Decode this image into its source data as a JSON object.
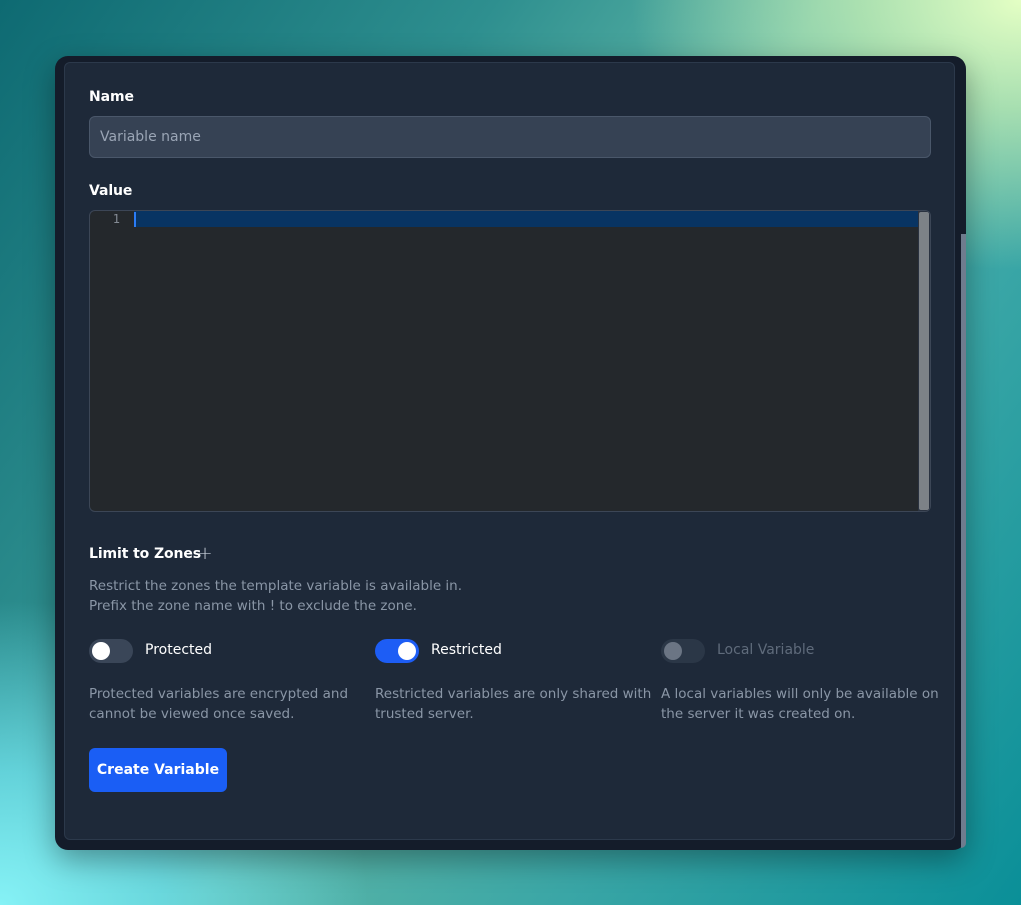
{
  "form": {
    "name": {
      "label": "Name",
      "value": "",
      "placeholder": "Variable name"
    },
    "value": {
      "label": "Value",
      "line_numbers": [
        "1"
      ],
      "content": ""
    },
    "zones": {
      "label": "Limit to Zones",
      "add_icon": "plus-icon",
      "add_glyph": "+",
      "help_lines": [
        "Restrict the zones the template variable is available in.",
        "Prefix the zone name with ! to exclude the zone."
      ]
    },
    "options": [
      {
        "label": "Protected",
        "checked": false,
        "disabled": false,
        "help_lines": [
          "Protected variables are encrypted and",
          "cannot be viewed once saved."
        ]
      },
      {
        "label": "Restricted",
        "checked": true,
        "disabled": false,
        "help_lines": [
          "Restricted variables are only shared with",
          "trusted server."
        ]
      },
      {
        "label": "Local Variable",
        "checked": false,
        "disabled": true,
        "help_lines": [
          "A local variables will only be available on",
          "the server it was created on."
        ]
      }
    ],
    "submit_label": "Create Variable"
  },
  "colors": {
    "card_background": "#1e2939",
    "accent": "#1a5ef5",
    "toggle_on": "#1d5df5",
    "editor_background": "#24282c",
    "editor_active_line": "#083463"
  }
}
